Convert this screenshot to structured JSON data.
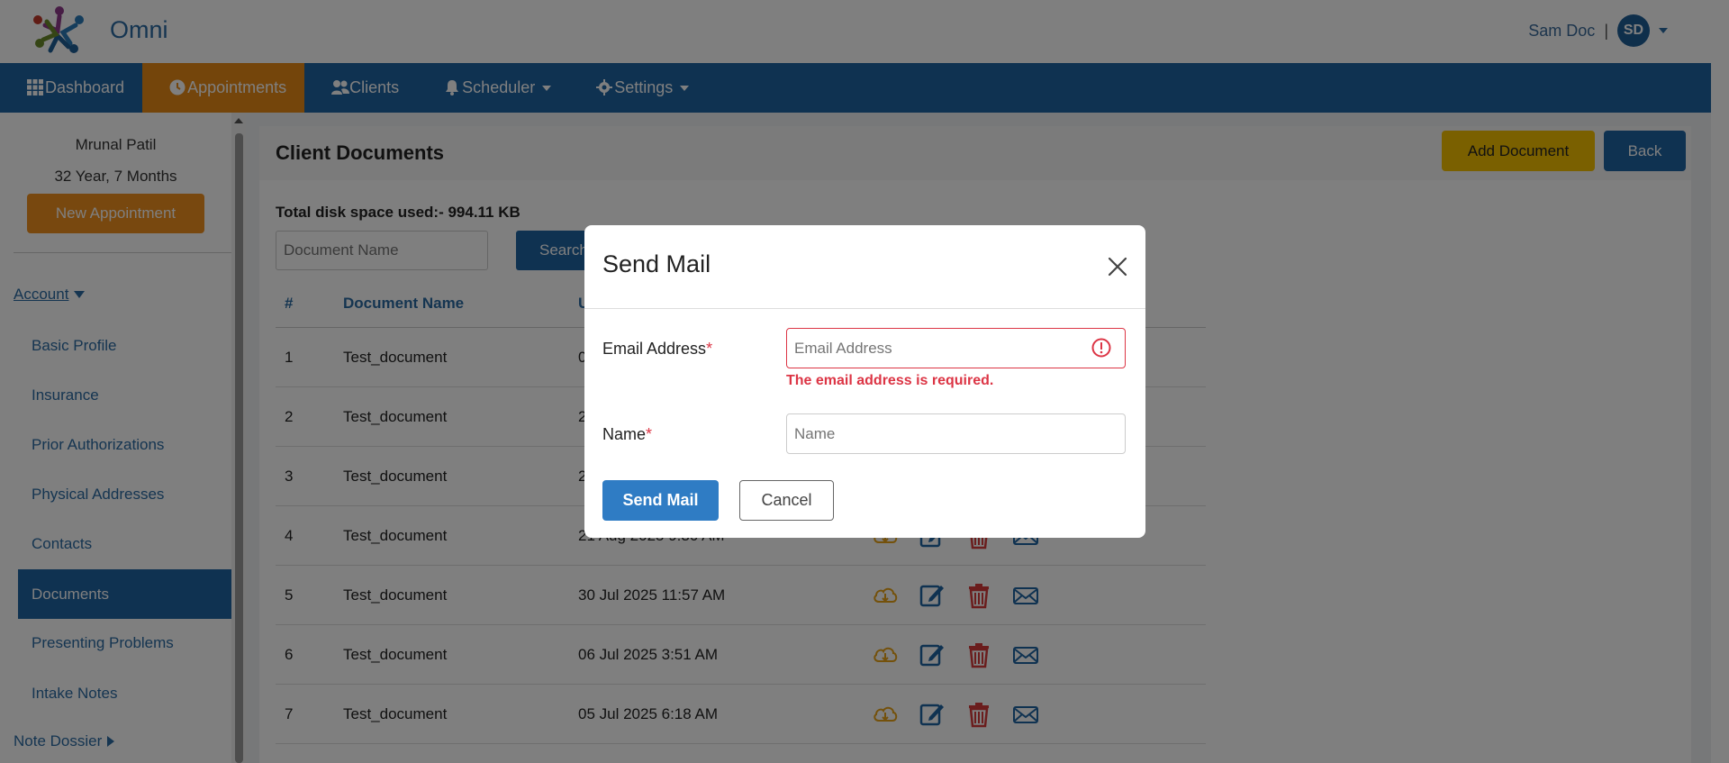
{
  "app": {
    "brand": "Omni"
  },
  "header": {
    "user_name": "Sam Doc",
    "separator": "|",
    "avatar_initials": "SD"
  },
  "nav": {
    "items": [
      {
        "label": "Dashboard"
      },
      {
        "label": "Appointments"
      },
      {
        "label": "Clients"
      },
      {
        "label": "Scheduler"
      },
      {
        "label": "Settings"
      }
    ]
  },
  "sidebar": {
    "client_name": "Mrunal Patil",
    "client_age": "32 Year, 7 Months",
    "new_appointment": "New Appointment",
    "account_label": "Account",
    "items": [
      {
        "label": "Basic Profile"
      },
      {
        "label": "Insurance"
      },
      {
        "label": "Prior Authorizations"
      },
      {
        "label": "Physical Addresses"
      },
      {
        "label": "Contacts"
      },
      {
        "label": "Documents"
      },
      {
        "label": "Presenting Problems"
      },
      {
        "label": "Intake Notes"
      }
    ],
    "note_dossier_label": "Note Dossier"
  },
  "main": {
    "title": "Client Documents",
    "add_document": "Add Document",
    "back": "Back",
    "disk_space": "Total disk space used:- 994.11 KB",
    "search_placeholder": "Document Name",
    "search_button": "Search",
    "table": {
      "headers": [
        "#",
        "Document Name",
        "U"
      ],
      "rows": [
        {
          "num": "1",
          "name": "Test_document",
          "date": "0"
        },
        {
          "num": "2",
          "name": "Test_document",
          "date": "2"
        },
        {
          "num": "3",
          "name": "Test_document",
          "date": "2"
        },
        {
          "num": "4",
          "name": "Test_document",
          "date": "21 Aug 2025 9:30 AM"
        },
        {
          "num": "5",
          "name": "Test_document",
          "date": "30 Jul 2025 11:57 AM"
        },
        {
          "num": "6",
          "name": "Test_document",
          "date": "06 Jul 2025 3:51 AM"
        },
        {
          "num": "7",
          "name": "Test_document",
          "date": "05 Jul 2025 6:18 AM"
        }
      ]
    }
  },
  "modal": {
    "title": "Send Mail",
    "email_label": "Email Address",
    "required_mark": "*",
    "email_placeholder": "Email Address",
    "email_error": "The email address is required.",
    "name_label": "Name",
    "name_placeholder": "Name",
    "send_button": "Send Mail",
    "cancel_button": "Cancel"
  },
  "colors": {
    "nav_bg": "#1f64a3",
    "nav_active": "#e98b16",
    "add_doc": "#f5c000",
    "error": "#dc3545",
    "download_icon": "#e8a317",
    "delete_icon": "#d63b3b"
  }
}
